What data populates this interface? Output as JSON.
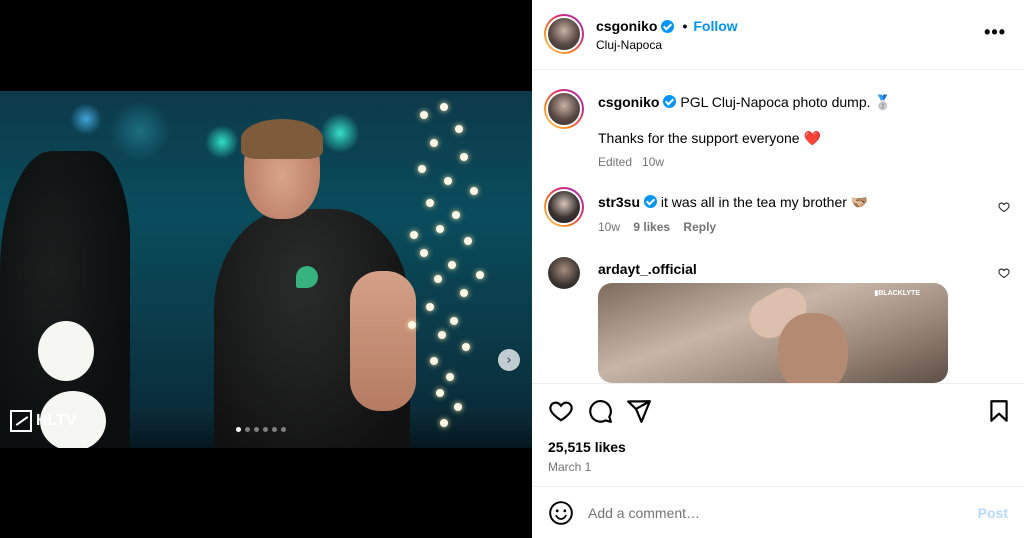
{
  "post": {
    "author": {
      "username": "csgoniko",
      "verified": true,
      "location": "Cluj-Napoca"
    },
    "header": {
      "separator": "•",
      "follow_label": "Follow",
      "more_label": "•••"
    },
    "caption": {
      "username": "csgoniko",
      "text": "PGL Cluj-Napoca photo dump. 🥈",
      "line2": "Thanks for the support everyone ❤️",
      "meta_edited": "Edited",
      "meta_time": "10w"
    },
    "comments": [
      {
        "username": "str3su",
        "verified": true,
        "text": "it was all in the tea my brother 🫱🏼‍🫲🏽",
        "time": "10w",
        "likes": "9 likes",
        "reply_label": "Reply"
      },
      {
        "username": "ardayt_.official",
        "verified": false,
        "text": "",
        "attachment_tag": "▮BLACKLYTE"
      }
    ],
    "media": {
      "watermark": "HLTV",
      "carousel_total": 6,
      "carousel_index": 1,
      "next_icon": "›"
    },
    "stats": {
      "likes": "25,515 likes",
      "date": "March 1"
    },
    "add_comment": {
      "placeholder": "Add a comment…",
      "post_label": "Post"
    },
    "icons": {
      "like": "heart-icon",
      "comment": "comment-bubble-icon",
      "share": "paper-plane-icon",
      "save": "bookmark-icon",
      "emoji": "smiley-icon",
      "more": "more-options-icon"
    },
    "colors": {
      "accent": "#0095f6",
      "muted": "#737373",
      "post_disabled": "#b3dbff",
      "heart_red": "#ed4956"
    }
  }
}
